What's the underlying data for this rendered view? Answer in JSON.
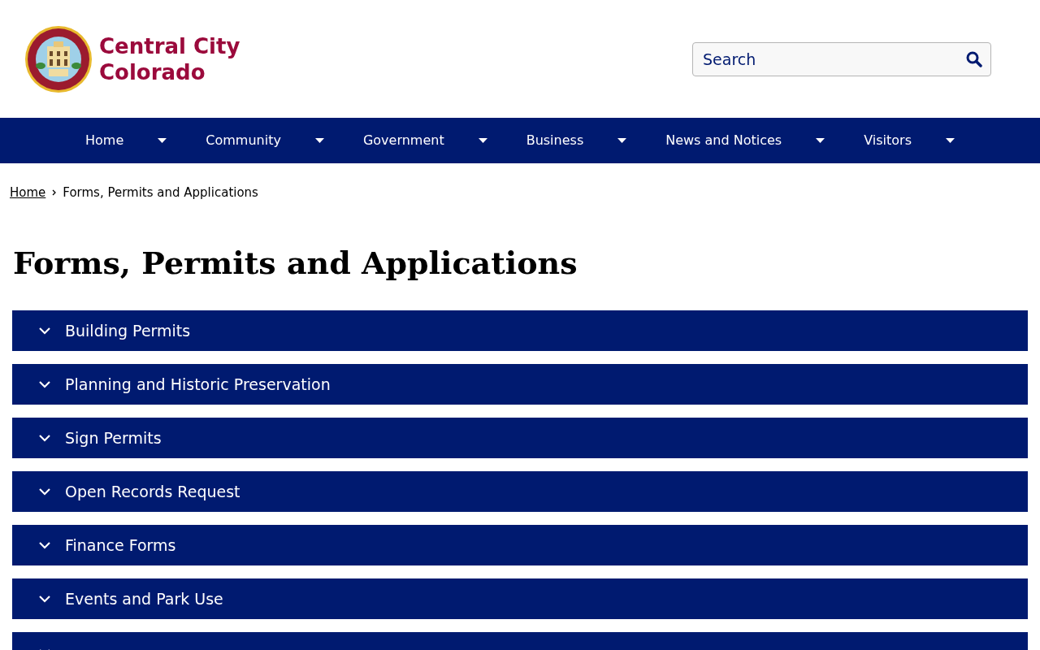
{
  "site": {
    "title_lines": [
      "Central City",
      "Colorado"
    ]
  },
  "search": {
    "placeholder": "Search"
  },
  "nav": [
    {
      "label": "Home"
    },
    {
      "label": "Community"
    },
    {
      "label": "Government"
    },
    {
      "label": "Business"
    },
    {
      "label": "News and Notices"
    },
    {
      "label": "Visitors"
    }
  ],
  "breadcrumb": [
    {
      "label": "Home",
      "kind": "link"
    },
    {
      "label": "Forms, Permits and Applications",
      "kind": "current"
    }
  ],
  "page_title": "Forms, Permits and Applications",
  "accordion": [
    {
      "label": "Building Permits",
      "expanded": false
    },
    {
      "label": "Planning and Historic Preservation",
      "expanded": false
    },
    {
      "label": "Sign Permits",
      "expanded": false
    },
    {
      "label": "Open Records Request",
      "expanded": false
    },
    {
      "label": "Finance Forms",
      "expanded": false
    },
    {
      "label": "Events and Park Use",
      "expanded": false
    },
    {
      "expanded": false
    }
  ]
}
